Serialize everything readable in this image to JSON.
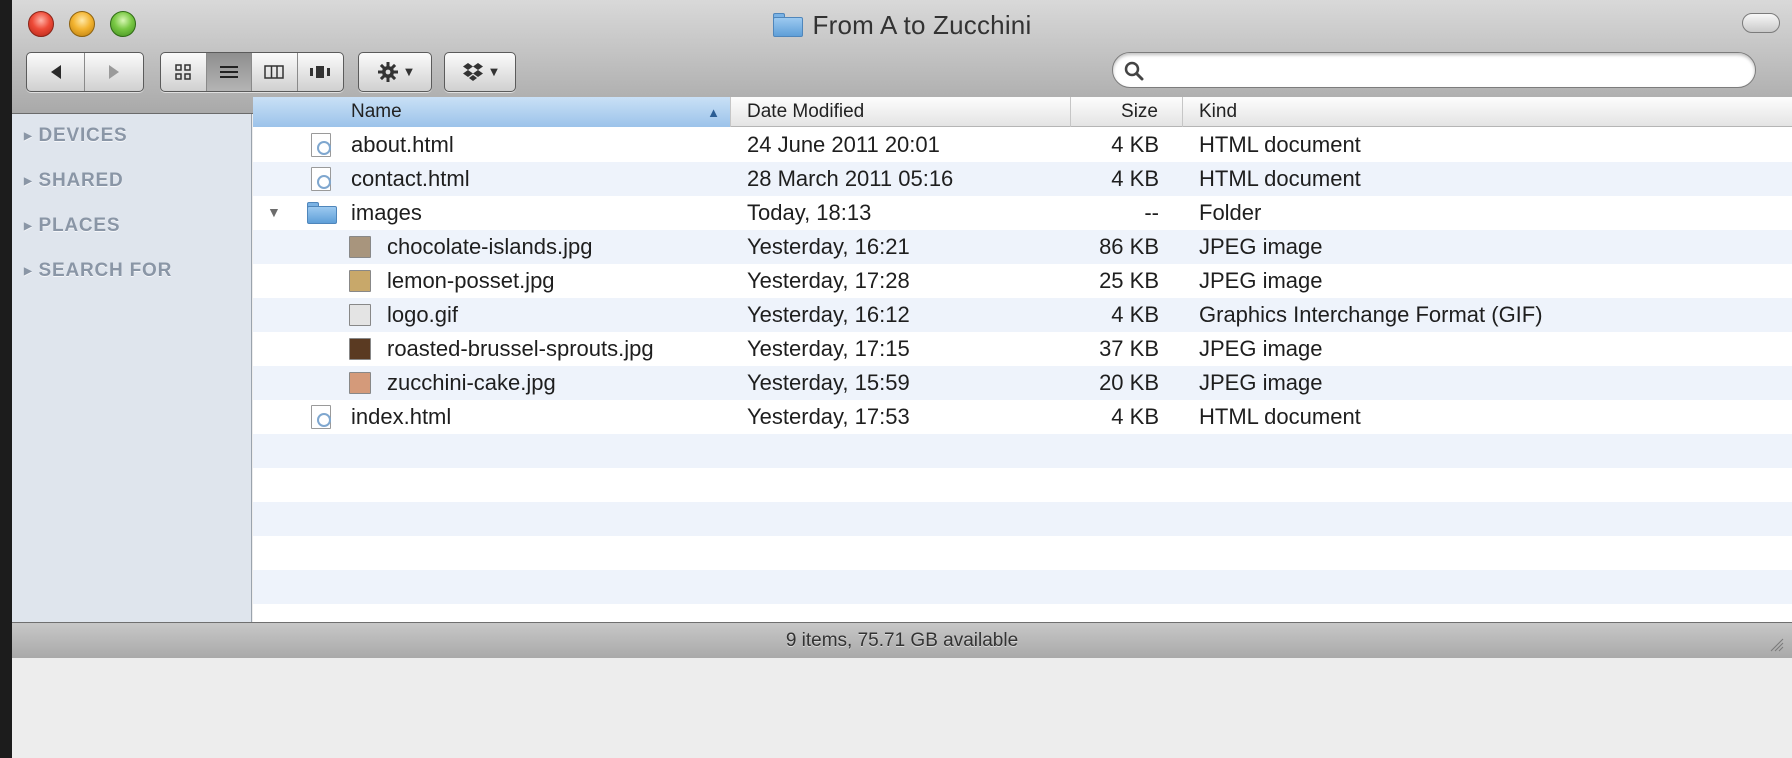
{
  "window": {
    "title": "From A to Zucchini"
  },
  "toolbar": {
    "back_icon": "back-arrow-icon",
    "forward_icon": "forward-arrow-icon",
    "views": [
      "icon-view",
      "list-view",
      "column-view",
      "cover-flow-view"
    ],
    "selected_view": "list-view",
    "action_icon": "gear-icon",
    "dropbox_icon": "dropbox-icon",
    "search": {
      "value": "",
      "placeholder": ""
    }
  },
  "sidebar": {
    "sections": [
      {
        "label": "DEVICES"
      },
      {
        "label": "SHARED"
      },
      {
        "label": "PLACES"
      },
      {
        "label": "SEARCH FOR"
      }
    ]
  },
  "columns": {
    "name": "Name",
    "date": "Date Modified",
    "size": "Size",
    "kind": "Kind",
    "sorted_by": "Name"
  },
  "files": [
    {
      "name": "about.html",
      "date": "24 June 2011 20:01",
      "size": "4 KB",
      "kind": "HTML document",
      "icon": "html-document-icon",
      "level": 0
    },
    {
      "name": "contact.html",
      "date": "28 March 2011 05:16",
      "size": "4 KB",
      "kind": "HTML document",
      "icon": "html-document-icon",
      "level": 0
    },
    {
      "name": "images",
      "date": "Today, 18:13",
      "size": "--",
      "kind": "Folder",
      "icon": "folder-icon",
      "level": 0,
      "expanded": true
    },
    {
      "name": "chocolate-islands.jpg",
      "date": "Yesterday, 16:21",
      "size": "86 KB",
      "kind": "JPEG image",
      "icon": "jpeg-image-icon",
      "level": 1,
      "thumb": "#a8957d"
    },
    {
      "name": "lemon-posset.jpg",
      "date": "Yesterday, 17:28",
      "size": "25 KB",
      "kind": "JPEG image",
      "icon": "jpeg-image-icon",
      "level": 1,
      "thumb": "#c8a86a"
    },
    {
      "name": "logo.gif",
      "date": "Yesterday, 16:12",
      "size": "4 KB",
      "kind": "Graphics Interchange Format (GIF)",
      "icon": "gif-image-icon",
      "level": 1,
      "thumb": "#e4e4e4"
    },
    {
      "name": "roasted-brussel-sprouts.jpg",
      "date": "Yesterday, 17:15",
      "size": "37 KB",
      "kind": "JPEG image",
      "icon": "jpeg-image-icon",
      "level": 1,
      "thumb": "#5a3a22"
    },
    {
      "name": "zucchini-cake.jpg",
      "date": "Yesterday, 15:59",
      "size": "20 KB",
      "kind": "JPEG image",
      "icon": "jpeg-image-icon",
      "level": 1,
      "thumb": "#d49a7a"
    },
    {
      "name": "index.html",
      "date": "Yesterday, 17:53",
      "size": "4 KB",
      "kind": "HTML document",
      "icon": "html-document-icon",
      "level": 0
    }
  ],
  "status": {
    "text": "9 items, 75.71 GB available"
  },
  "colors": {
    "sidebar_bg": "#dfe5ed",
    "alt_row": "#eef3fb",
    "sort_header": "#b3d2f0"
  }
}
